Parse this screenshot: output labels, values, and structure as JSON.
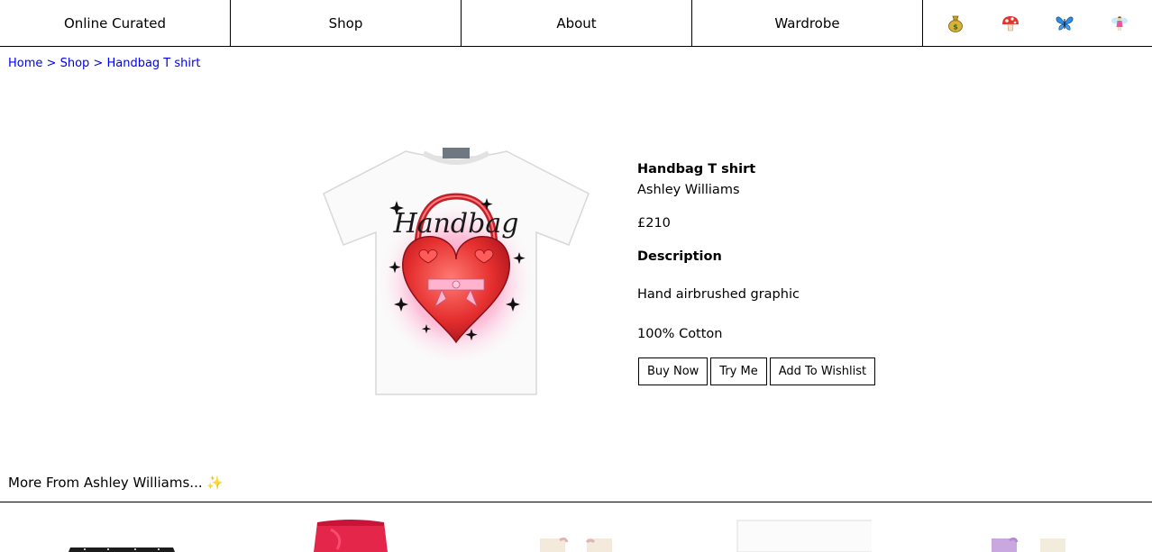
{
  "nav": {
    "items": [
      {
        "label": "Online Curated"
      },
      {
        "label": "Shop"
      },
      {
        "label": "About"
      },
      {
        "label": "Wardrobe"
      }
    ],
    "icons": [
      "money-bag-icon",
      "mushroom-icon",
      "butterfly-icon",
      "fairy-icon"
    ]
  },
  "breadcrumb": {
    "home": "Home",
    "shop": "Shop",
    "current": "Handbag T shirt",
    "separator": ">"
  },
  "product": {
    "name": "Handbag T shirt",
    "brand": "Ashley Williams",
    "price": "£210",
    "description_heading": "Description",
    "description_lines": [
      "Hand airbrushed graphic",
      "100% Cotton"
    ],
    "graphic_text": "Handbag"
  },
  "actions": {
    "buy": "Buy Now",
    "try": "Try Me",
    "wishlist": "Add To Wishlist"
  },
  "more": {
    "title": "More From Ashley Williams... ✨"
  },
  "colors": {
    "link": "#0000ee",
    "heart_red": "#e32636",
    "glow_pink": "#ff6fa8"
  }
}
